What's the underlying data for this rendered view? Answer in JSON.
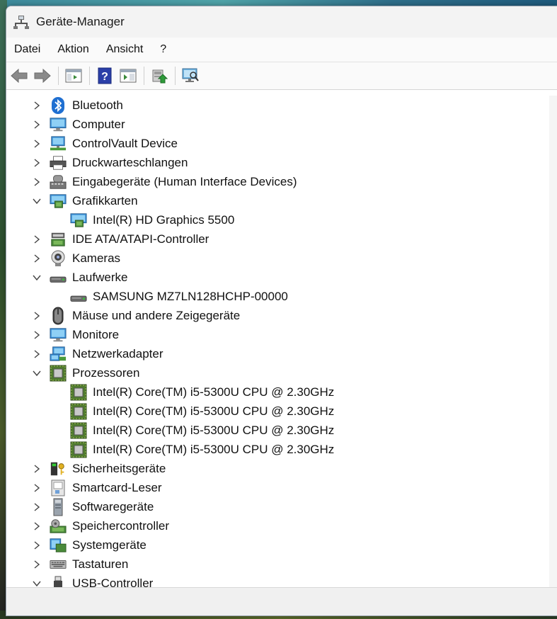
{
  "window": {
    "title": "Geräte-Manager"
  },
  "menu": {
    "items": [
      "Datei",
      "Aktion",
      "Ansicht",
      "?"
    ]
  },
  "toolbar": {
    "buttons": [
      "back-icon",
      "forward-icon",
      "console-tree-icon",
      "help-icon",
      "properties-icon",
      "update-driver-icon",
      "scan-hardware-icon"
    ]
  },
  "tree": {
    "rows": [
      {
        "label": "Bluetooth",
        "icon": "bluetooth-icon",
        "expanded": false
      },
      {
        "label": "Computer",
        "icon": "computer-icon",
        "expanded": false
      },
      {
        "label": "ControlVault Device",
        "icon": "controlvault-icon",
        "expanded": false
      },
      {
        "label": "Druckwarteschlangen",
        "icon": "printer-icon",
        "expanded": false
      },
      {
        "label": "Eingabegeräte (Human Interface Devices)",
        "icon": "hid-icon",
        "expanded": false
      },
      {
        "label": "Grafikkarten",
        "icon": "display-adapter-icon",
        "expanded": true
      },
      {
        "label": "Intel(R) HD Graphics 5500",
        "icon": "display-adapter-icon",
        "child": true
      },
      {
        "label": "IDE ATA/ATAPI-Controller",
        "icon": "ide-controller-icon",
        "expanded": false
      },
      {
        "label": "Kameras",
        "icon": "camera-icon",
        "expanded": false
      },
      {
        "label": "Laufwerke",
        "icon": "disk-drive-icon",
        "expanded": true
      },
      {
        "label": "SAMSUNG MZ7LN128HCHP-00000",
        "icon": "disk-drive-icon",
        "child": true
      },
      {
        "label": "Mäuse und andere Zeigegeräte",
        "icon": "mouse-icon",
        "expanded": false
      },
      {
        "label": "Monitore",
        "icon": "monitor-icon",
        "expanded": false
      },
      {
        "label": "Netzwerkadapter",
        "icon": "network-adapter-icon",
        "expanded": false
      },
      {
        "label": "Prozessoren",
        "icon": "processor-icon",
        "expanded": true
      },
      {
        "label": "Intel(R) Core(TM) i5-5300U CPU @ 2.30GHz",
        "icon": "processor-icon",
        "child": true
      },
      {
        "label": "Intel(R) Core(TM) i5-5300U CPU @ 2.30GHz",
        "icon": "processor-icon",
        "child": true
      },
      {
        "label": "Intel(R) Core(TM) i5-5300U CPU @ 2.30GHz",
        "icon": "processor-icon",
        "child": true
      },
      {
        "label": "Intel(R) Core(TM) i5-5300U CPU @ 2.30GHz",
        "icon": "processor-icon",
        "child": true
      },
      {
        "label": "Sicherheitsgeräte",
        "icon": "security-device-icon",
        "expanded": false
      },
      {
        "label": "Smartcard-Leser",
        "icon": "smartcard-reader-icon",
        "expanded": false
      },
      {
        "label": "Softwaregeräte",
        "icon": "software-device-icon",
        "expanded": false
      },
      {
        "label": "Speichercontroller",
        "icon": "storage-controller-icon",
        "expanded": false
      },
      {
        "label": "Systemgeräte",
        "icon": "system-device-icon",
        "expanded": false
      },
      {
        "label": "Tastaturen",
        "icon": "keyboard-icon",
        "expanded": false
      },
      {
        "label": "USB-Controller",
        "icon": "usb-icon",
        "expanded": true
      }
    ]
  },
  "colors": {
    "accent": "#1f6fd1",
    "chevron": "#444444",
    "chip_green": "#5b8a3a"
  }
}
